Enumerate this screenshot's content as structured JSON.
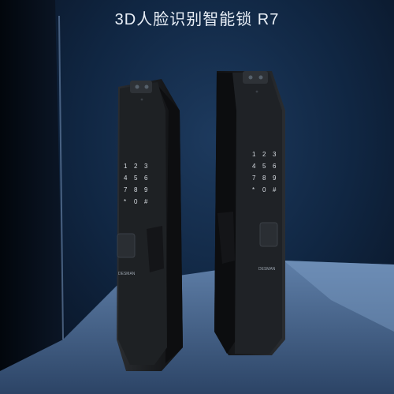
{
  "headline": "3D人脸识别智能锁 R7",
  "products": [
    {
      "name": "smart-lock-left",
      "keypad": [
        "1",
        "2",
        "3",
        "4",
        "5",
        "6",
        "7",
        "8",
        "9",
        "*",
        "0",
        "#"
      ],
      "brand": "DESMAN"
    },
    {
      "name": "smart-lock-right",
      "keypad": [
        "1",
        "2",
        "3",
        "4",
        "5",
        "6",
        "7",
        "8",
        "9",
        "*",
        "0",
        "#"
      ],
      "brand": "DESMAN"
    }
  ],
  "colors": {
    "background": "#102642",
    "lock_body": "#1a1c1f",
    "accent_light": "#6f8bb0"
  }
}
